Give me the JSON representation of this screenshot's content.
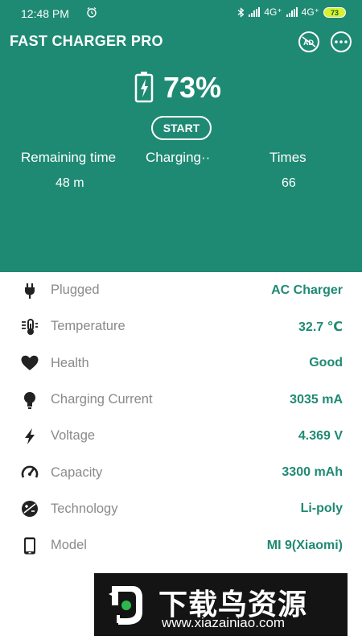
{
  "status_bar": {
    "time": "12:48 PM",
    "network_1": "4G⁺",
    "network_2": "4G⁺",
    "battery": "73"
  },
  "app": {
    "title": "FAST CHARGER PRO",
    "icons": [
      "ad-off-icon",
      "more-options-icon"
    ]
  },
  "battery": {
    "percent_text": "73%",
    "level": 73,
    "icon": "charging-battery-icon"
  },
  "start_button": {
    "label": "START"
  },
  "stats": [
    {
      "label": "Remaining time",
      "value": "48 m"
    },
    {
      "label": "Charging··",
      "value": ""
    },
    {
      "label": "Times",
      "value": "66"
    }
  ],
  "info": [
    {
      "icon": "plug-icon",
      "label": "Plugged",
      "value": "AC Charger"
    },
    {
      "icon": "thermometer-icon",
      "label": "Temperature",
      "value": "32.7 ℃"
    },
    {
      "icon": "heart-icon",
      "label": "Health",
      "value": "Good"
    },
    {
      "icon": "bulb-icon",
      "label": "Charging Current",
      "value": "3035 mA"
    },
    {
      "icon": "lightning-icon",
      "label": "Voltage",
      "value": "4.369 V"
    },
    {
      "icon": "gauge-icon",
      "label": "Capacity",
      "value": "3300 mAh"
    },
    {
      "icon": "technology-icon",
      "label": "Technology",
      "value": "Li-poly"
    },
    {
      "icon": "phone-icon",
      "label": "Model",
      "value": "MI 9(Xiaomi)"
    }
  ],
  "watermark": {
    "title": "下载鸟资源",
    "url": "www.xiazainiao.com"
  },
  "colors": {
    "accent": "#1f8a73",
    "label_gray": "#8a8a8a",
    "icon_dark": "#222222"
  }
}
